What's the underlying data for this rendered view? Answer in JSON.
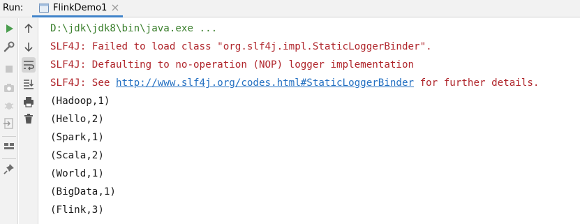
{
  "run_bar": {
    "label": "Run:",
    "tab": {
      "title": "FlinkDemo1",
      "icon": "run-config-icon",
      "close_icon": "close-icon"
    }
  },
  "toolbar_left": [
    "rerun-icon",
    "wrench-icon",
    "stop-icon",
    "camera-icon",
    "exit-icon",
    "layout-icon",
    "pin-icon"
  ],
  "toolbar_right": [
    "up-arrow-icon",
    "down-arrow-icon",
    "soft-wrap-icon",
    "scroll-to-end-icon",
    "print-icon",
    "trash-icon"
  ],
  "console": {
    "command": "D:\\jdk\\jdk8\\bin\\java.exe ...",
    "warnings": [
      "SLF4J: Failed to load class \"org.slf4j.impl.StaticLoggerBinder\".",
      "SLF4J: Defaulting to no-operation (NOP) logger implementation"
    ],
    "see_prefix": "SLF4J: See ",
    "see_link": "http://www.slf4j.org/codes.html#StaticLoggerBinder",
    "see_suffix": " for further details.",
    "output": [
      "(Hadoop,1)",
      "(Hello,2)",
      "(Spark,1)",
      "(Scala,2)",
      "(World,1)",
      "(BigData,1)",
      "(Flink,3)"
    ]
  },
  "colors": {
    "command": "#3a7f2c",
    "error": "#b0262c",
    "link": "#2470c2",
    "tab_underline": "#4083c9"
  }
}
